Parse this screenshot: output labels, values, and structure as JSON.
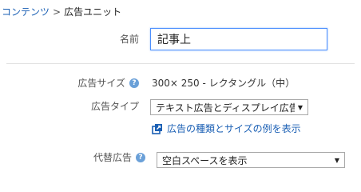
{
  "breadcrumb": {
    "parent": "コンテンツ",
    "separator": ">",
    "current": "広告ユニット"
  },
  "form": {
    "name": {
      "label": "名前",
      "value": "記事上"
    },
    "ad_size": {
      "label": "広告サイズ",
      "value": "300× 250 - レクタングル（中）"
    },
    "ad_type": {
      "label": "広告タイプ",
      "selected": "テキスト広告とディスプレイ広告"
    },
    "examples_link": "広告の種類とサイズの例を表示",
    "alternate_ads": {
      "label": "代替広告",
      "selected": "空白スペースを表示"
    }
  },
  "icons": {
    "help": "help-icon",
    "external": "external-link-icon",
    "caret": "caret-down-icon"
  },
  "colors": {
    "link": "#1a5fb4",
    "focus_border": "#4d90fe",
    "help_icon": "#6aa0d8"
  }
}
